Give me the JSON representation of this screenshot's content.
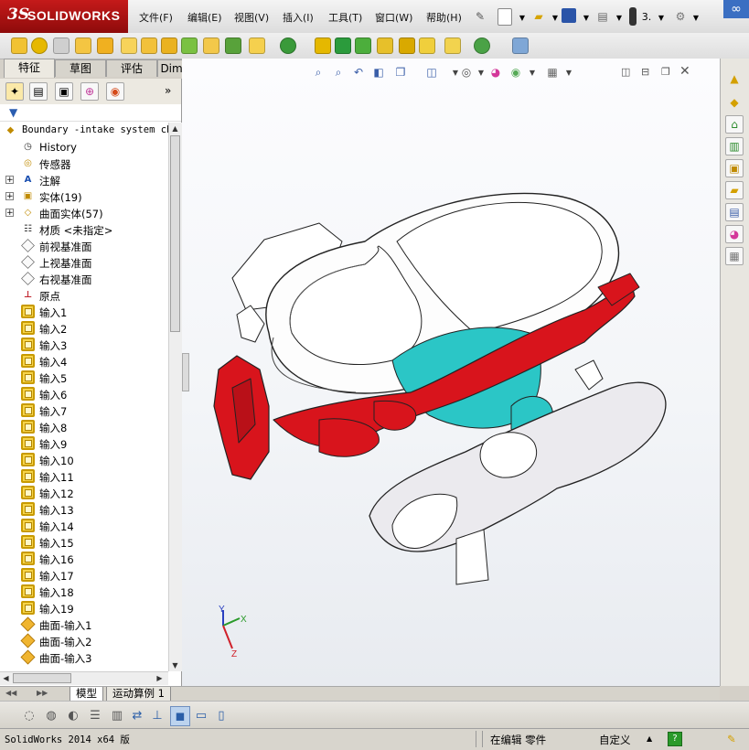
{
  "app": {
    "logo_prefix": "3S",
    "logo_name": "SOLIDWORKS"
  },
  "menu": [
    "文件(F)",
    "编辑(E)",
    "视图(V)",
    "插入(I)",
    "工具(T)",
    "窗口(W)",
    "帮助(H)"
  ],
  "title_toolbar": {
    "info_label": "3."
  },
  "feature_tabs": [
    "特征",
    "草图",
    "评估",
    "DimXpert"
  ],
  "tree": {
    "root": "Boundary -intake system ch",
    "items": [
      {
        "label": "History",
        "icon": "history-icon",
        "expand": ""
      },
      {
        "label": "传感器",
        "icon": "sensor-icon",
        "expand": ""
      },
      {
        "label": "注解",
        "icon": "annotation-icon",
        "expand": "+"
      },
      {
        "label": "实体(19)",
        "icon": "solid-bodies-icon",
        "expand": "+"
      },
      {
        "label": "曲面实体(57)",
        "icon": "surface-bodies-icon",
        "expand": "+"
      },
      {
        "label": "材质 <未指定>",
        "icon": "material-icon",
        "expand": ""
      },
      {
        "label": "前视基准面",
        "icon": "plane-icon",
        "expand": ""
      },
      {
        "label": "上视基准面",
        "icon": "plane-icon",
        "expand": ""
      },
      {
        "label": "右视基准面",
        "icon": "plane-icon",
        "expand": ""
      },
      {
        "label": "原点",
        "icon": "origin-icon",
        "expand": ""
      },
      {
        "label": "输入1",
        "icon": "imported-body-icon",
        "expand": ""
      },
      {
        "label": "输入2",
        "icon": "imported-body-icon",
        "expand": ""
      },
      {
        "label": "输入3",
        "icon": "imported-body-icon",
        "expand": ""
      },
      {
        "label": "输入4",
        "icon": "imported-body-icon",
        "expand": ""
      },
      {
        "label": "输入5",
        "icon": "imported-body-icon",
        "expand": ""
      },
      {
        "label": "输入6",
        "icon": "imported-body-icon",
        "expand": ""
      },
      {
        "label": "输入7",
        "icon": "imported-body-icon",
        "expand": ""
      },
      {
        "label": "输入8",
        "icon": "imported-body-icon",
        "expand": ""
      },
      {
        "label": "输入9",
        "icon": "imported-body-icon",
        "expand": ""
      },
      {
        "label": "输入10",
        "icon": "imported-body-icon",
        "expand": ""
      },
      {
        "label": "输入11",
        "icon": "imported-body-icon",
        "expand": ""
      },
      {
        "label": "输入12",
        "icon": "imported-body-icon",
        "expand": ""
      },
      {
        "label": "输入13",
        "icon": "imported-body-icon",
        "expand": ""
      },
      {
        "label": "输入14",
        "icon": "imported-body-icon",
        "expand": ""
      },
      {
        "label": "输入15",
        "icon": "imported-body-icon",
        "expand": ""
      },
      {
        "label": "输入16",
        "icon": "imported-body-icon",
        "expand": ""
      },
      {
        "label": "输入17",
        "icon": "imported-body-icon",
        "expand": ""
      },
      {
        "label": "输入18",
        "icon": "imported-body-icon",
        "expand": ""
      },
      {
        "label": "输入19",
        "icon": "imported-body-icon",
        "expand": ""
      },
      {
        "label": "曲面-输入1",
        "icon": "imported-surface-icon",
        "expand": ""
      },
      {
        "label": "曲面-输入2",
        "icon": "imported-surface-icon",
        "expand": ""
      },
      {
        "label": "曲面-输入3",
        "icon": "imported-surface-icon",
        "expand": ""
      }
    ]
  },
  "bottom_tabs": [
    "模型",
    "运动算例 1"
  ],
  "status": {
    "version": "SolidWorks 2014 x64 版",
    "mode": "在编辑 零件",
    "units": "自定义",
    "help": "?"
  },
  "triad": {
    "y": "Y",
    "x": "X",
    "z": "Z"
  },
  "colors": {
    "part_red": "#d8141c",
    "part_cyan": "#2bc6c6",
    "part_white": "#ffffff",
    "edge_dark": "#222222",
    "gray_panel": "#d4d0c8",
    "brand_red": "#c51a1a"
  }
}
